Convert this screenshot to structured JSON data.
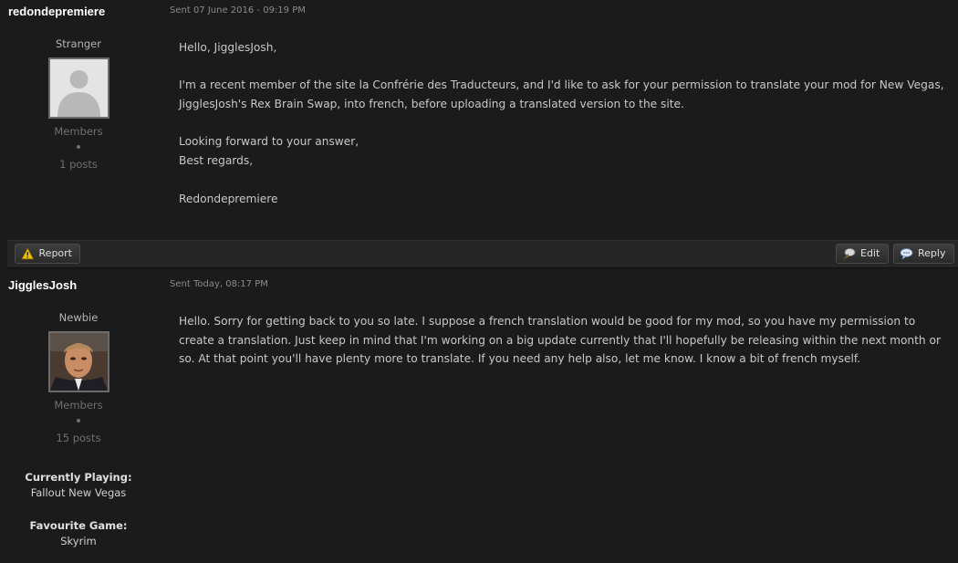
{
  "posts": [
    {
      "author": "redondepremiere",
      "date": "Sent 07 June 2016 - 09:19 PM",
      "rank": "Stranger",
      "group": "Members",
      "post_count": "1 posts",
      "avatar": "default-avatar",
      "paragraphs": [
        "Hello, JigglesJosh,",
        "I'm a recent member of the site la Confrérie des Traducteurs, and I'd like to ask for your permission to translate your mod for New Vegas, JigglesJosh's Rex Brain Swap, into french, before uploading a translated version to the site.",
        "Looking forward to your answer,\nBest regards,",
        "Redondepremiere"
      ],
      "actions": {
        "report": "Report",
        "edit": "Edit",
        "reply": "Reply"
      }
    },
    {
      "author": "JigglesJosh",
      "date": "Sent Today, 08:17 PM",
      "rank": "Newbie",
      "group": "Members",
      "post_count": "15 posts",
      "avatar": "user-photo-avatar",
      "paragraphs": [
        "Hello. Sorry for getting back to you so late. I suppose a french translation would be good for my mod, so you have my permission to create a translation. Just keep in mind that I'm working on a big update currently that I'll hopefully be releasing within the next month or so. At that point you'll have plenty more to translate. If you need any help also, let me know. I know a bit of french myself."
      ],
      "profile_fields": [
        {
          "label": "Currently Playing:",
          "value": "Fallout New Vegas"
        },
        {
          "label": "Favourite Game:",
          "value": "Skyrim"
        }
      ]
    }
  ],
  "icons": {
    "report": "warning-triangle-icon",
    "edit": "edit-speech-icon",
    "reply": "reply-bubble-icon"
  },
  "colors": {
    "background": "#1b1b1b",
    "footer_bar": "#262626",
    "author_name": "#ffffff",
    "body_text": "#c8c8c8",
    "muted_text": "#6f6f6f"
  }
}
